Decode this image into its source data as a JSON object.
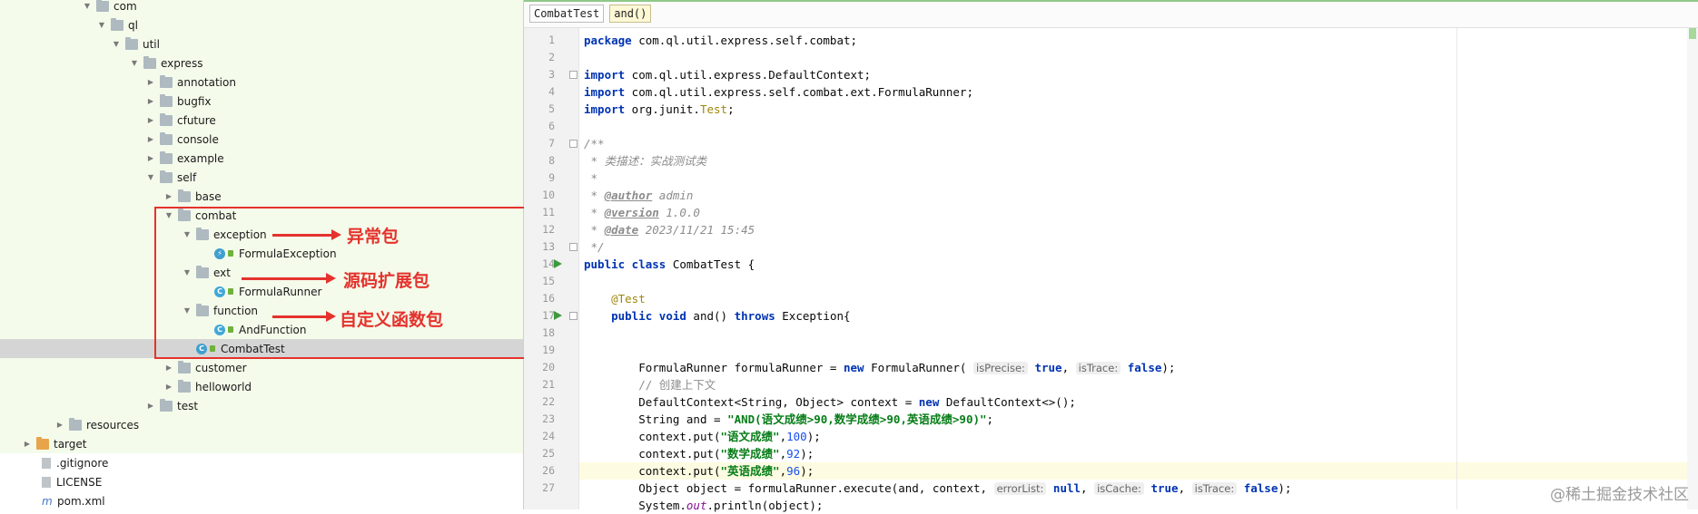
{
  "tree": {
    "rows": [
      {
        "label": "com",
        "arrow": "▼"
      },
      {
        "label": "ql",
        "arrow": "▼"
      },
      {
        "label": "util",
        "arrow": "▼"
      },
      {
        "label": "express",
        "arrow": "▼"
      },
      {
        "label": "annotation",
        "arrow": "▶"
      },
      {
        "label": "bugfix",
        "arrow": "▶"
      },
      {
        "label": "cfuture",
        "arrow": "▶"
      },
      {
        "label": "console",
        "arrow": "▶"
      },
      {
        "label": "example",
        "arrow": "▶"
      },
      {
        "label": "self",
        "arrow": "▼"
      },
      {
        "label": "base",
        "arrow": "▶"
      },
      {
        "label": "combat",
        "arrow": "▼"
      },
      {
        "label": "exception",
        "arrow": "▼"
      },
      {
        "label": "FormulaException",
        "arrow": ""
      },
      {
        "label": "ext",
        "arrow": "▼"
      },
      {
        "label": "FormulaRunner",
        "arrow": ""
      },
      {
        "label": "function",
        "arrow": "▼"
      },
      {
        "label": "AndFunction",
        "arrow": ""
      },
      {
        "label": "CombatTest",
        "arrow": ""
      },
      {
        "label": "customer",
        "arrow": "▶"
      },
      {
        "label": "helloworld",
        "arrow": "▶"
      },
      {
        "label": "test",
        "arrow": "▶"
      },
      {
        "label": "resources",
        "arrow": "▶"
      },
      {
        "label": "target",
        "arrow": "▶"
      },
      {
        "label": ".gitignore",
        "arrow": ""
      },
      {
        "label": "LICENSE",
        "arrow": ""
      },
      {
        "label": "pom.xml",
        "arrow": ""
      }
    ],
    "class_badges": {
      "exception_badge": "⚡",
      "class_badge": "C"
    }
  },
  "annotations": {
    "exception_pkg": "异常包",
    "ext_pkg": "源码扩展包",
    "function_pkg": "自定义函数包"
  },
  "breadcrumb": {
    "class_name": "CombatTest",
    "method_name": "and()"
  },
  "code": {
    "line_numbers": [
      "1",
      "2",
      "3",
      "4",
      "5",
      "6",
      "7",
      "8",
      "9",
      "10",
      "11",
      "12",
      "13",
      "14",
      "15",
      "16",
      "17",
      "18",
      "19",
      "20",
      "21",
      "22",
      "23",
      "24",
      "25",
      "26",
      "27"
    ],
    "l1_kw": "package",
    "l1_rest": " com.ql.util.express.self.combat;",
    "import_kw": "import",
    "l3_rest": " com.ql.util.express.DefaultContext;",
    "l4_rest": " com.ql.util.express.self.combat.ext.FormulaRunner;",
    "l5_rest": " org.junit.",
    "l5_test": "Test",
    "l7": "/**",
    "l8": " * 类描述：实战测试类",
    "l9": " *",
    "l10_pre": " * ",
    "l10_tag": "@author",
    "l10_val": " admin",
    "l11_pre": " * ",
    "l11_tag": "@version",
    "l11_val": " 1.0.0",
    "l12_pre": " * ",
    "l12_tag": "@date",
    "l12_val": " 2023/11/21 15:45",
    "l13": " */",
    "l14_kw": "public class",
    "l14_rest": " CombatTest {",
    "l16_ann": "@Test",
    "l17_kw1": "public void",
    "l17_mid": " and() ",
    "l17_kw2": "throws",
    "l17_rest": " Exception{",
    "l20_a": "FormulaRunner formulaRunner = ",
    "new_kw": "new",
    "l20_b": " FormulaRunner( ",
    "hint_isPrecise": "isPrecise:",
    "true_kw": "true",
    "comma": ", ",
    "hint_isTrace": "isTrace:",
    "false_kw": "false",
    "l20_end": ");",
    "l21": "// 创建上下文",
    "l22_a": "DefaultContext<String, Object> context = ",
    "l22_b": " DefaultContext<>();",
    "l23_a": "String and = ",
    "l23_str": "\"AND(语文成绩>90,数学成绩>90,英语成绩>90)\"",
    "l23_end": ";",
    "put_pre": "context.put(",
    "l24_str": "\"语文成绩\"",
    "l24_num": "100",
    "l25_str": "\"数学成绩\"",
    "l25_num": "92",
    "l26_str": "\"英语成绩\"",
    "l26_num": "96",
    "put_mid": ",",
    "put_end": ");",
    "l27_a": "Object object = formulaRunner.execute(and, context, ",
    "hint_errorList": "errorList:",
    "null_kw": "null",
    "hint_isCache": "isCache:",
    "l27_end": ");",
    "l28_a": "System.",
    "l28_out": "out",
    "l28_b": ".println(object);"
  },
  "watermark": "@稀土掘金技术社区"
}
